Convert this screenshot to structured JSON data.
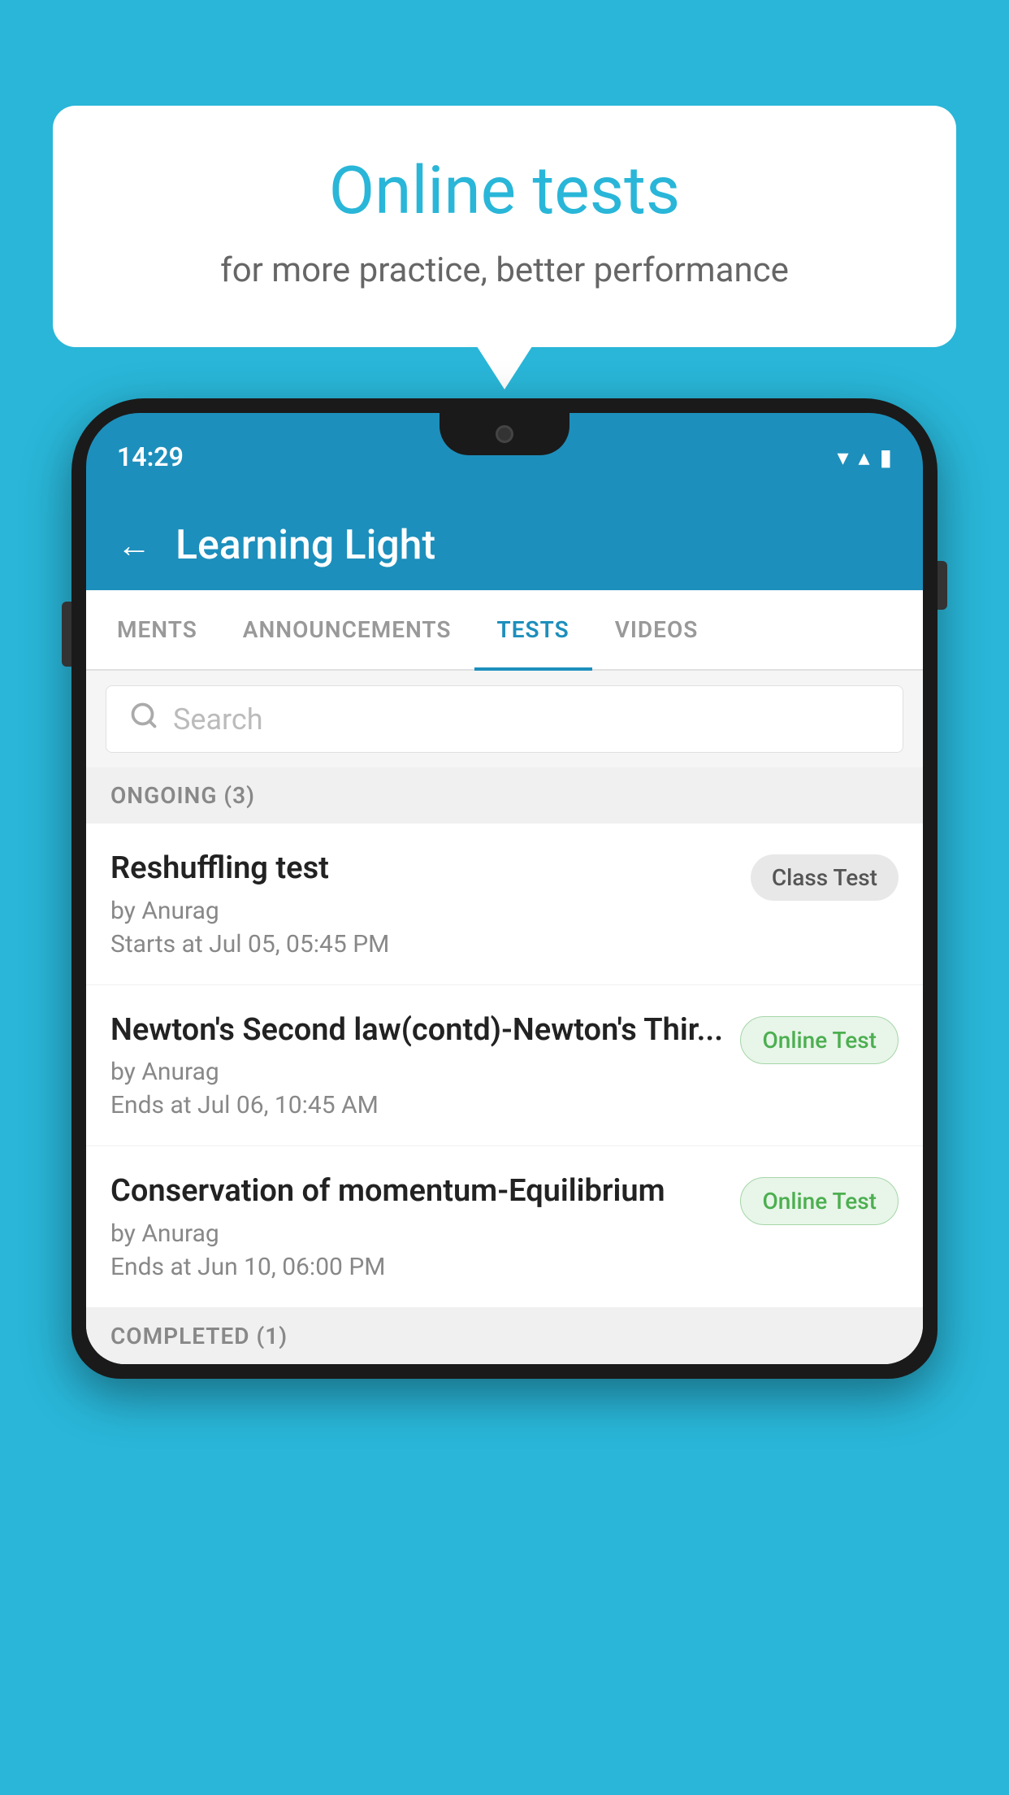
{
  "background_color": "#29b6d8",
  "bubble": {
    "title": "Online tests",
    "subtitle": "for more practice, better performance"
  },
  "status_bar": {
    "time": "14:29",
    "wifi": "▼",
    "signal": "▲",
    "battery": "▮"
  },
  "app": {
    "title": "Learning Light",
    "back_label": "←"
  },
  "tabs": [
    {
      "label": "MENTS",
      "active": false
    },
    {
      "label": "ANNOUNCEMENTS",
      "active": false
    },
    {
      "label": "TESTS",
      "active": true
    },
    {
      "label": "VIDEOS",
      "active": false
    }
  ],
  "search": {
    "placeholder": "Search"
  },
  "ongoing_section": {
    "title": "ONGOING (3)",
    "tests": [
      {
        "name": "Reshuffling test",
        "by": "by Anurag",
        "date": "Starts at  Jul 05, 05:45 PM",
        "badge": "Class Test",
        "badge_type": "class"
      },
      {
        "name": "Newton's Second law(contd)-Newton's Thir...",
        "by": "by Anurag",
        "date": "Ends at  Jul 06, 10:45 AM",
        "badge": "Online Test",
        "badge_type": "online"
      },
      {
        "name": "Conservation of momentum-Equilibrium",
        "by": "by Anurag",
        "date": "Ends at  Jun 10, 06:00 PM",
        "badge": "Online Test",
        "badge_type": "online"
      }
    ]
  },
  "completed_section": {
    "title": "COMPLETED (1)"
  }
}
